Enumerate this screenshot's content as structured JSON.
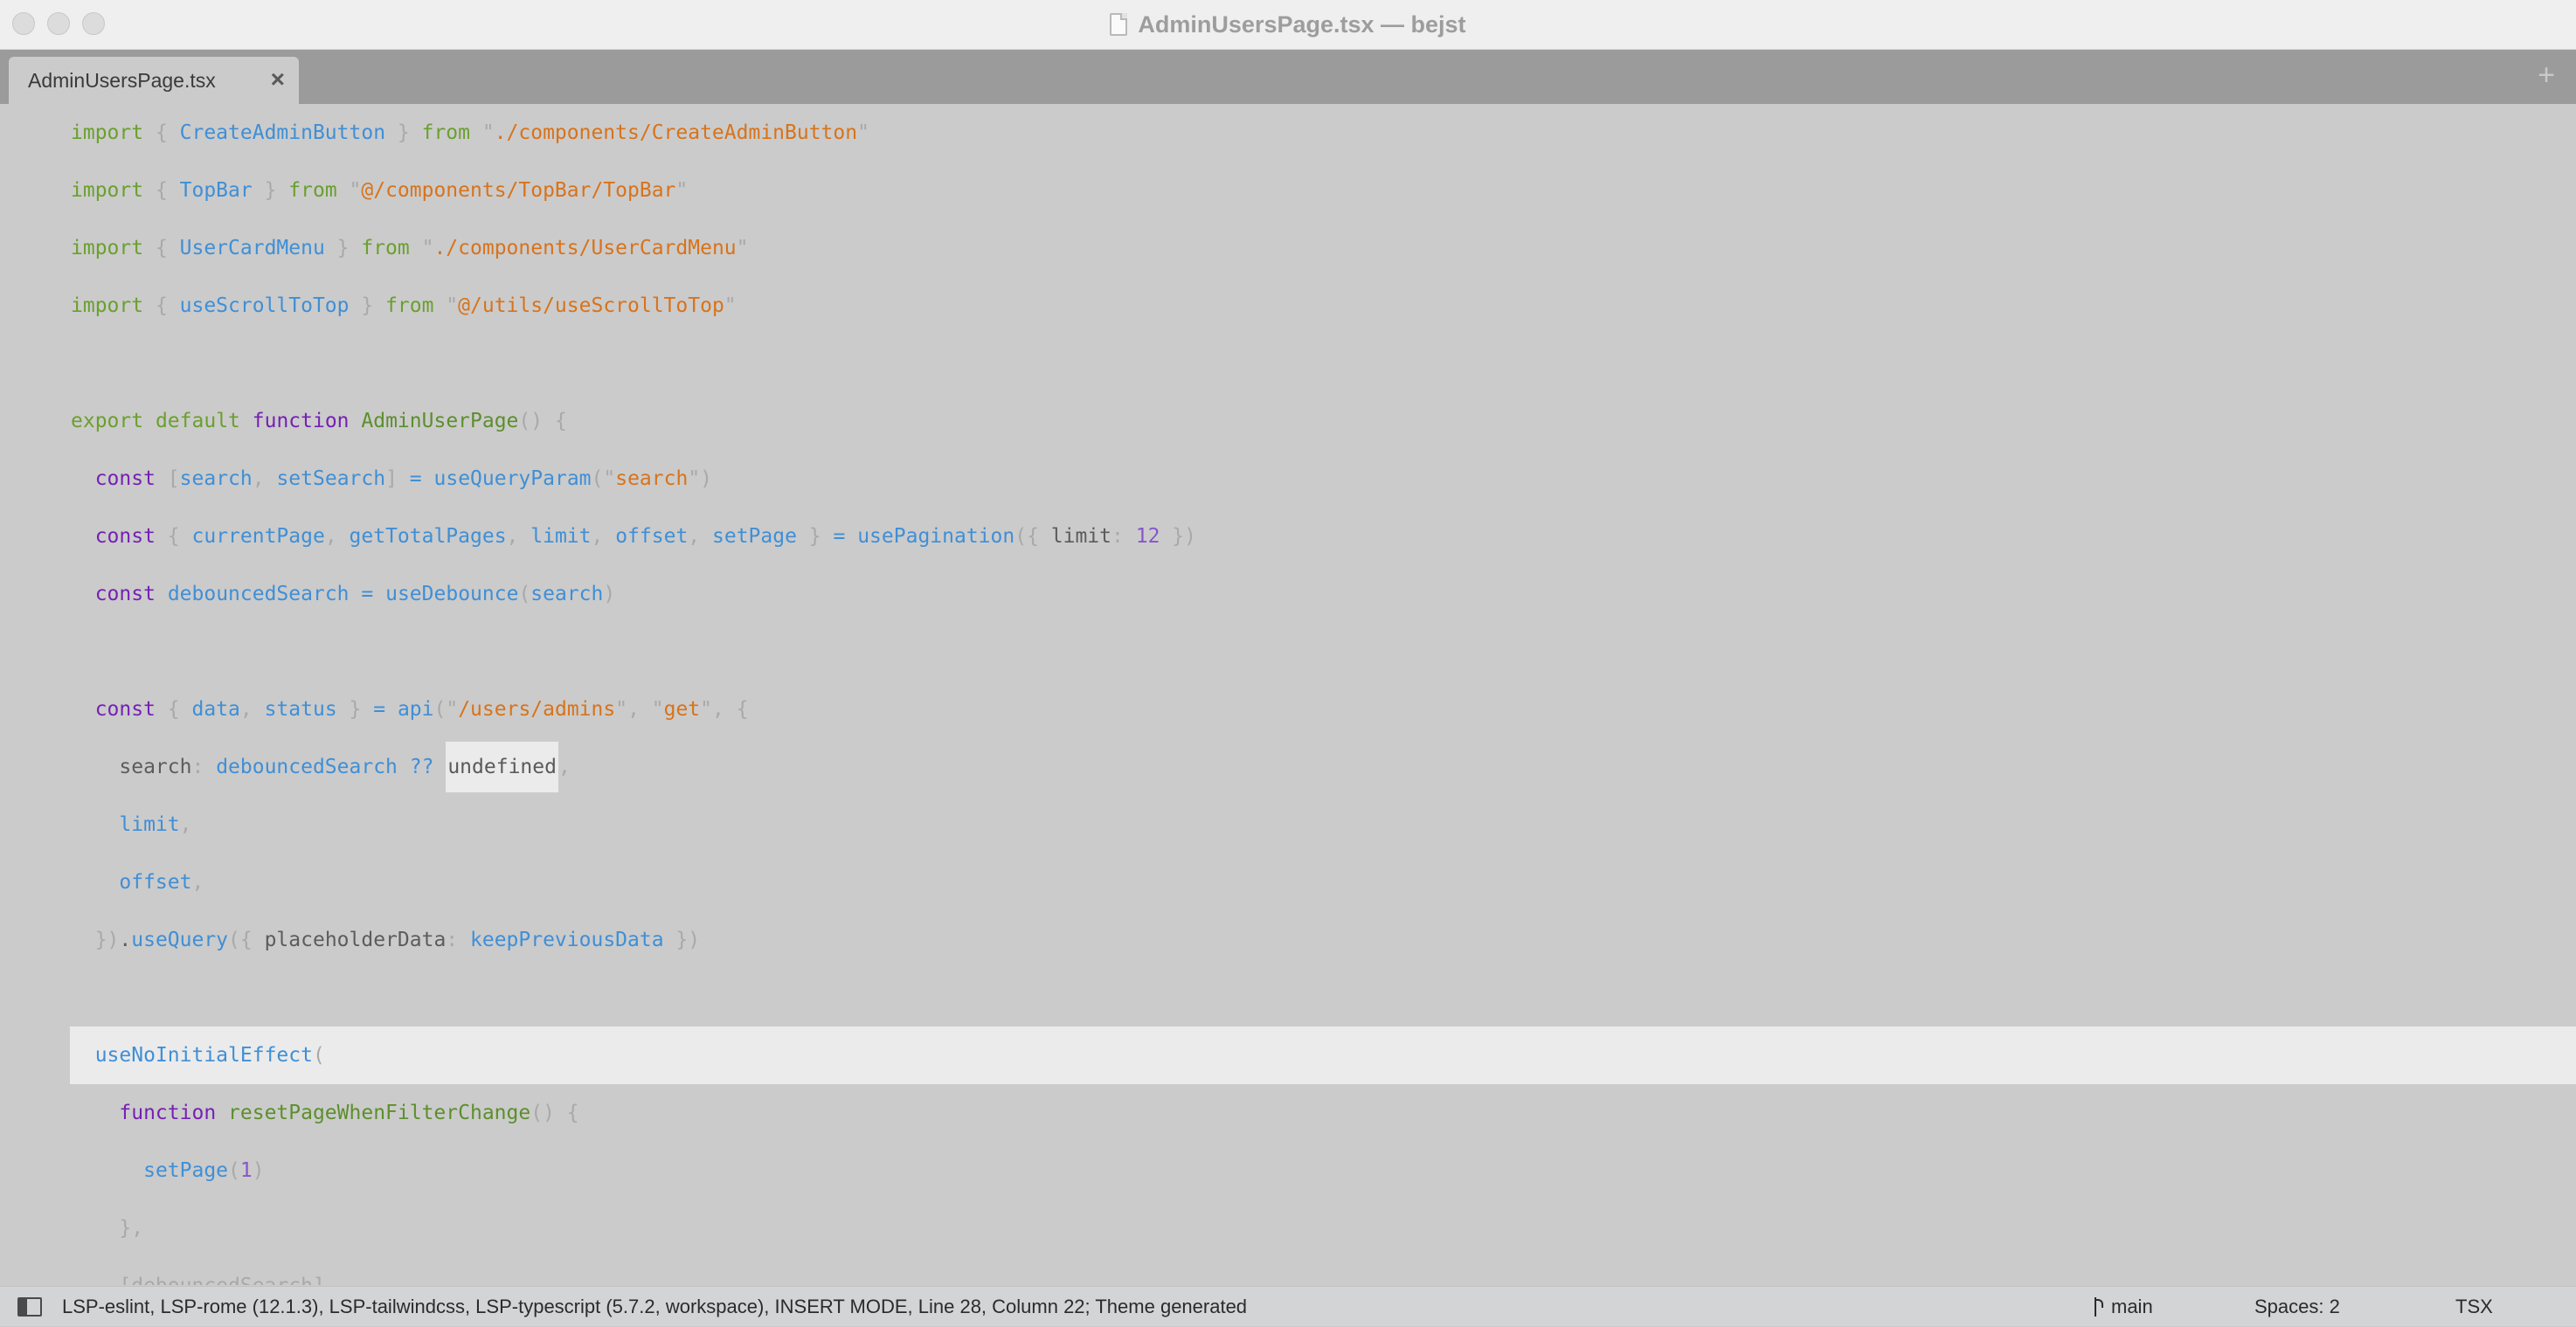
{
  "window": {
    "title": "AdminUsersPage.tsx — bejst"
  },
  "tabs": [
    {
      "label": "AdminUsersPage.tsx",
      "close_glyph": "×"
    }
  ],
  "tabbar": {
    "add_glyph": "+"
  },
  "editor": {
    "active_line": 28,
    "lines": [
      [
        [
          "k",
          "import"
        ],
        [
          "p",
          " { "
        ],
        [
          "id",
          "CreateAdminButton"
        ],
        [
          "p",
          " } "
        ],
        [
          "k",
          "from"
        ],
        [
          "p",
          " \""
        ],
        [
          "s",
          "./components/CreateAdminButton"
        ],
        [
          "p",
          "\""
        ]
      ],
      [
        [
          "k",
          "import"
        ],
        [
          "p",
          " { "
        ],
        [
          "id",
          "TopBar"
        ],
        [
          "p",
          " } "
        ],
        [
          "k",
          "from"
        ],
        [
          "p",
          " \""
        ],
        [
          "s",
          "@/components/TopBar/TopBar"
        ],
        [
          "p",
          "\""
        ]
      ],
      [
        [
          "k",
          "import"
        ],
        [
          "p",
          " { "
        ],
        [
          "id",
          "UserCardMenu"
        ],
        [
          "p",
          " } "
        ],
        [
          "k",
          "from"
        ],
        [
          "p",
          " \""
        ],
        [
          "s",
          "./components/UserCardMenu"
        ],
        [
          "p",
          "\""
        ]
      ],
      [
        [
          "k",
          "import"
        ],
        [
          "p",
          " { "
        ],
        [
          "id",
          "useScrollToTop"
        ],
        [
          "p",
          " } "
        ],
        [
          "k",
          "from"
        ],
        [
          "p",
          " \""
        ],
        [
          "s",
          "@/utils/useScrollToTop"
        ],
        [
          "p",
          "\""
        ]
      ],
      [],
      [
        [
          "k",
          "export"
        ],
        [
          "d",
          " "
        ],
        [
          "k",
          "default"
        ],
        [
          "d",
          " "
        ],
        [
          "kf",
          "function"
        ],
        [
          "d",
          " "
        ],
        [
          "fn",
          "AdminUserPage"
        ],
        [
          "p",
          "() {"
        ]
      ],
      [
        [
          "d",
          "  "
        ],
        [
          "kf",
          "const"
        ],
        [
          "p",
          " ["
        ],
        [
          "id",
          "search"
        ],
        [
          "p",
          ", "
        ],
        [
          "id",
          "setSearch"
        ],
        [
          "p",
          "] "
        ],
        [
          "id",
          "="
        ],
        [
          "d",
          " "
        ],
        [
          "id",
          "useQueryParam"
        ],
        [
          "p",
          "(\""
        ],
        [
          "s",
          "search"
        ],
        [
          "p",
          "\")"
        ]
      ],
      [
        [
          "d",
          "  "
        ],
        [
          "kf",
          "const"
        ],
        [
          "p",
          " { "
        ],
        [
          "id",
          "currentPage"
        ],
        [
          "p",
          ", "
        ],
        [
          "id",
          "getTotalPages"
        ],
        [
          "p",
          ", "
        ],
        [
          "id",
          "limit"
        ],
        [
          "p",
          ", "
        ],
        [
          "id",
          "offset"
        ],
        [
          "p",
          ", "
        ],
        [
          "id",
          "setPage"
        ],
        [
          "p",
          " } "
        ],
        [
          "id",
          "="
        ],
        [
          "d",
          " "
        ],
        [
          "id",
          "usePagination"
        ],
        [
          "p",
          "({ "
        ],
        [
          "d",
          "limit"
        ],
        [
          "p",
          ": "
        ],
        [
          "n",
          "12"
        ],
        [
          "p",
          " })"
        ]
      ],
      [
        [
          "d",
          "  "
        ],
        [
          "kf",
          "const"
        ],
        [
          "d",
          " "
        ],
        [
          "id",
          "debouncedSearch"
        ],
        [
          "d",
          " "
        ],
        [
          "id",
          "="
        ],
        [
          "d",
          " "
        ],
        [
          "id",
          "useDebounce"
        ],
        [
          "p",
          "("
        ],
        [
          "id",
          "search"
        ],
        [
          "p",
          ")"
        ]
      ],
      [],
      [
        [
          "d",
          "  "
        ],
        [
          "kf",
          "const"
        ],
        [
          "p",
          " { "
        ],
        [
          "id",
          "data"
        ],
        [
          "p",
          ", "
        ],
        [
          "id",
          "status"
        ],
        [
          "p",
          " } "
        ],
        [
          "id",
          "="
        ],
        [
          "d",
          " "
        ],
        [
          "id",
          "api"
        ],
        [
          "p",
          "(\""
        ],
        [
          "s",
          "/users/admins"
        ],
        [
          "p",
          "\", \""
        ],
        [
          "s",
          "get"
        ],
        [
          "p",
          "\", {"
        ]
      ],
      [
        [
          "d",
          "    search"
        ],
        [
          "p",
          ": "
        ],
        [
          "id",
          "debouncedSearch"
        ],
        [
          "d",
          " "
        ],
        [
          "id",
          "??"
        ],
        [
          "d",
          " "
        ],
        [
          "sel",
          "undefined"
        ],
        [
          "p",
          ","
        ]
      ],
      [
        [
          "d",
          "    "
        ],
        [
          "id",
          "limit"
        ],
        [
          "p",
          ","
        ]
      ],
      [
        [
          "d",
          "    "
        ],
        [
          "id",
          "offset"
        ],
        [
          "p",
          ","
        ]
      ],
      [
        [
          "p",
          "  })"
        ],
        [
          "d",
          "."
        ],
        [
          "id",
          "useQuery"
        ],
        [
          "p",
          "({ "
        ],
        [
          "d",
          "placeholderData"
        ],
        [
          "p",
          ": "
        ],
        [
          "id",
          "keepPreviousData"
        ],
        [
          "p",
          " })"
        ]
      ],
      [],
      [
        [
          "d",
          "  "
        ],
        [
          "id",
          "useNoInitialEffect"
        ],
        [
          "p",
          "("
        ]
      ],
      [
        [
          "d",
          "    "
        ],
        [
          "kf",
          "function"
        ],
        [
          "d",
          " "
        ],
        [
          "fn",
          "resetPageWhenFilterChange"
        ],
        [
          "p",
          "() {"
        ]
      ],
      [
        [
          "d",
          "      "
        ],
        [
          "id",
          "setPage"
        ],
        [
          "p",
          "("
        ],
        [
          "n",
          "1"
        ],
        [
          "p",
          ")"
        ]
      ],
      [
        [
          "p",
          "    },"
        ]
      ],
      [
        [
          "p",
          "    [debouncedSearch],"
        ]
      ]
    ],
    "active_line_index": 16
  },
  "statusbar": {
    "status": "LSP-eslint, LSP-rome (12.1.3), LSP-tailwindcss, LSP-typescript (5.7.2, workspace), INSERT MODE, Line 28, Column 22; Theme generated",
    "branch": "main",
    "spaces": "Spaces: 2",
    "syntax": "TSX"
  },
  "icons": [
    "document-icon",
    "close-icon",
    "plus-icon",
    "sidebar-toggle-icon",
    "git-branch-icon"
  ],
  "colors": {
    "keyword": "#6aa02e",
    "storage": "#7620b5",
    "identifier": "#3f8fd6",
    "string": "#d8731a",
    "number": "#8656c9",
    "punctuation": "#a9a9a9",
    "background": "#cbcbcb",
    "active_line": "#ebebeb"
  }
}
